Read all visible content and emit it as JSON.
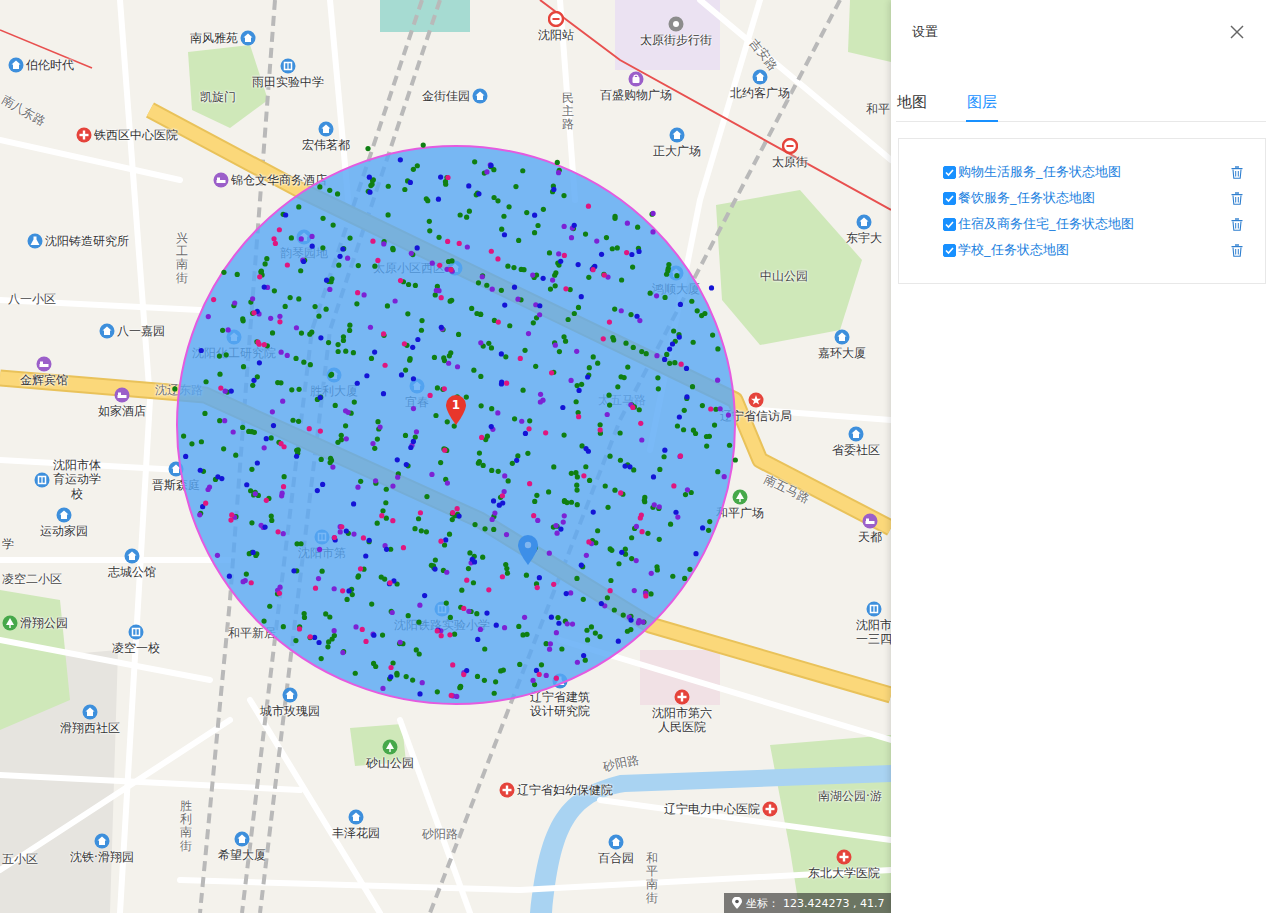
{
  "panel": {
    "title": "设置"
  },
  "tabs": [
    {
      "label": "地图",
      "selected": false
    },
    {
      "label": "图层",
      "selected": true
    }
  ],
  "layers": [
    {
      "label": "购物生活服务_任务状态地图",
      "checked": true,
      "color": "#0f7f12"
    },
    {
      "label": "餐饮服务_任务状态地图",
      "checked": true,
      "color": "#7c22d4"
    },
    {
      "label": "住宿及商务住宅_任务状态地图",
      "checked": true,
      "color": "#1414d6"
    },
    {
      "label": "学校_任务状态地图",
      "checked": true,
      "color": "#e0167f"
    }
  ],
  "map": {
    "labels": [
      {
        "text": "南风雅苑",
        "kind": "residence"
      },
      {
        "text": "伯伦时代",
        "kind": "residence"
      },
      {
        "text": "雨田实验中学",
        "kind": "school"
      },
      {
        "text": "金街佳园",
        "kind": "residence"
      },
      {
        "text": "沈阳站",
        "kind": "metro"
      },
      {
        "text": "太原街步行街",
        "kind": "place"
      },
      {
        "text": "百盛购物广场",
        "kind": "shop"
      },
      {
        "text": "北约客广场",
        "kind": "residence"
      },
      {
        "text": "正大广场",
        "kind": "residence"
      },
      {
        "text": "太原街",
        "kind": "metro"
      },
      {
        "text": "凯旋门",
        "kind": "area"
      },
      {
        "text": "铁西区中心医院",
        "kind": "hospital"
      },
      {
        "text": "宏伟茗都",
        "kind": "residence"
      },
      {
        "text": "锦仓文华商务酒店",
        "kind": "hotel"
      },
      {
        "text": "沈阳铸造研究所",
        "kind": "research"
      },
      {
        "text": "中山公园",
        "kind": "area"
      },
      {
        "text": "东宇大",
        "kind": "residence"
      },
      {
        "text": "和平",
        "kind": "area"
      },
      {
        "text": "八一小区",
        "kind": "area"
      },
      {
        "text": "八一嘉园",
        "kind": "residence"
      },
      {
        "text": "金辉宾馆",
        "kind": "hotel"
      },
      {
        "text": "如家酒店",
        "kind": "hotel"
      },
      {
        "text": "沈阳化工研究院",
        "kind": "residence"
      },
      {
        "text": "嘉环大厦",
        "kind": "residence"
      },
      {
        "text": "辽宁省信访局",
        "kind": "gov"
      },
      {
        "text": "省委社区",
        "kind": "residence"
      },
      {
        "text": "沈阳市体育运动学校",
        "kind": "school"
      },
      {
        "text": "晋斯森庭",
        "kind": "residence"
      },
      {
        "text": "和平广场",
        "kind": "park"
      },
      {
        "text": "天都",
        "kind": "hotel"
      },
      {
        "text": "运动家园",
        "kind": "residence"
      },
      {
        "text": "志城公馆",
        "kind": "residence"
      },
      {
        "text": "学",
        "kind": "area"
      },
      {
        "text": "凌空二小区",
        "kind": "area"
      },
      {
        "text": "滑翔公园",
        "kind": "park"
      },
      {
        "text": "凌空一校",
        "kind": "school"
      },
      {
        "text": "沈阳市一三四",
        "kind": "school"
      },
      {
        "text": "和平新居",
        "kind": "area"
      },
      {
        "text": "辽宁省建筑设计研究院",
        "kind": "research"
      },
      {
        "text": "沈阳市第六人民医院",
        "kind": "hospital"
      },
      {
        "text": "城市玫瑰园",
        "kind": "residence"
      },
      {
        "text": "滑翔西社区",
        "kind": "residence"
      },
      {
        "text": "砂山公园",
        "kind": "park"
      },
      {
        "text": "辽宁省妇幼保健院",
        "kind": "hospital"
      },
      {
        "text": "辽宁电力中心医院",
        "kind": "hospital"
      },
      {
        "text": "南湖公园·游",
        "kind": "area"
      },
      {
        "text": "丰泽花园",
        "kind": "residence"
      },
      {
        "text": "砂阳路",
        "kind": "road"
      },
      {
        "text": "东北大学医院",
        "kind": "hospital"
      },
      {
        "text": "五小区",
        "kind": "area"
      },
      {
        "text": "沈铁·滑翔园",
        "kind": "residence"
      },
      {
        "text": "希望大厦",
        "kind": "residence"
      },
      {
        "text": "百合园",
        "kind": "residence"
      },
      {
        "text": "沈辽东路",
        "kind": "road"
      },
      {
        "text": "南五马路",
        "kind": "road"
      },
      {
        "text": "砂阳路",
        "kind": "road"
      },
      {
        "text": "兴工南街",
        "kind": "road-vertical"
      },
      {
        "text": "民主路",
        "kind": "road-vertical"
      },
      {
        "text": "胜利南街",
        "kind": "road-vertical"
      },
      {
        "text": "和平南街",
        "kind": "road-vertical"
      },
      {
        "text": "吉安路",
        "kind": "road"
      },
      {
        "text": "南八东路",
        "kind": "road"
      },
      {
        "text": "韵琴园地",
        "kind": "residence"
      },
      {
        "text": "太原小区西区",
        "kind": "residence"
      },
      {
        "text": "胜利大厦",
        "kind": "residence"
      },
      {
        "text": "宜春",
        "kind": "residence"
      },
      {
        "text": "沈阳铁路实验小学",
        "kind": "school"
      },
      {
        "text": "鸿顺大厦",
        "kind": "residence"
      },
      {
        "text": "太五马路",
        "kind": "road"
      },
      {
        "text": "沈阳市第",
        "kind": "school"
      }
    ],
    "pins": [
      {
        "label": "1",
        "color": "#e8362b"
      },
      {
        "label": "",
        "color": "#3d8fe8"
      }
    ],
    "coordinates": {
      "label": "坐标：",
      "value": "123.424273 , 41.7"
    }
  }
}
